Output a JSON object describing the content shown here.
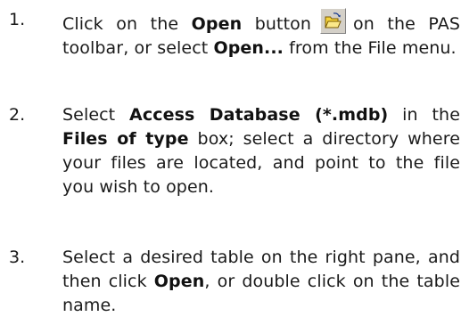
{
  "steps": [
    {
      "number": "1.",
      "t1": "Click on the ",
      "b1": "Open",
      "t2": " button",
      "t3": "on the PAS toolbar, or select ",
      "b2": "Open...",
      "t4": " from the File menu.",
      "icon": "open-folder-icon"
    },
    {
      "number": "2.",
      "t1": "Select ",
      "b1": "Access Database (*.mdb)",
      "t2": " in the ",
      "b2": "Files of type",
      "t3": " box; select a directory where your files are located, and point to the file you wish to open."
    },
    {
      "number": "3.",
      "t1": "Select a desired table on the right pane, and then click ",
      "b1": "Open",
      "t2": ", or double click on the table name."
    }
  ],
  "colors": {
    "text": "#1a1a1a",
    "icon_face": "#d4d0c8",
    "folder_yellow": "#f5d33a",
    "folder_outline": "#7a5a00"
  }
}
